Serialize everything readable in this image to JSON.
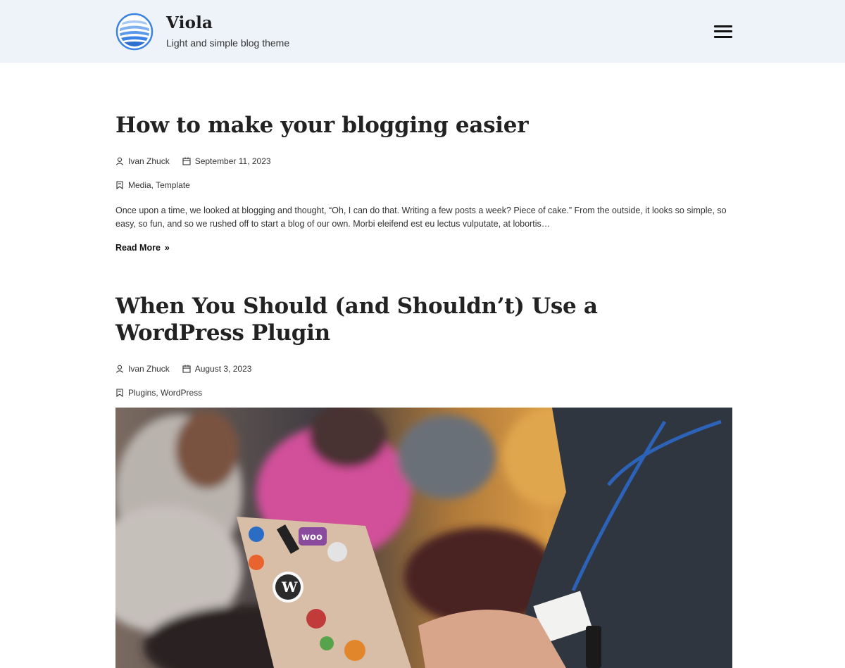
{
  "site": {
    "title": "Viola",
    "tagline": "Light and simple blog theme",
    "logo_icon": "globe-icon",
    "menu_icon": "hamburger-icon"
  },
  "posts": [
    {
      "title": "How to make your blogging easier",
      "author": "Ivan Zhuck",
      "date": "September 11, 2023",
      "categories": "Media, Template",
      "excerpt": "Once upon a time, we looked at blogging and thought, “Oh, I can do that. Writing a few posts a week? Piece of cake.” From the outside, it looks so simple, so easy, so fun, and so we rushed off to start a blog of our own. Morbi eleifend est eu lectus vulputate, at lobortis…",
      "read_more": "Read More",
      "read_more_arrow": "»"
    },
    {
      "title": "When You Should (and Shouldn’t) Use a WordPress Plugin",
      "author": "Ivan Zhuck",
      "date": "August 3, 2023",
      "categories": "Plugins, WordPress"
    }
  ],
  "colors": {
    "header_bg": "#eef2f9",
    "logo_blue": "#3b82e6",
    "text": "#222222"
  }
}
